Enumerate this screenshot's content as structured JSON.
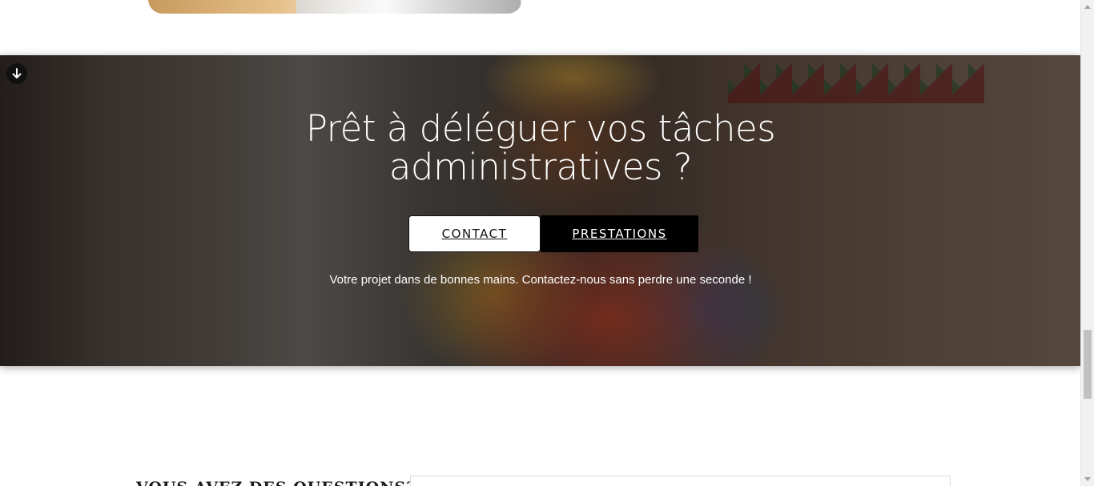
{
  "hero": {
    "title": "Prêt à déléguer vos tâches administratives ?",
    "buttons": {
      "contact_label": "CONTACT",
      "prestations_label": "PRESTATIONS"
    },
    "text": "Votre projet dans de bonnes mains. Contactez-nous sans perdre une seconde !",
    "scroll_icon": "arrow-down-icon"
  },
  "faq": {
    "heading": "VOUS AVEZ DES QUESTIONS?"
  },
  "colors": {
    "primary_dark": "#000000",
    "light": "#ffffff"
  }
}
